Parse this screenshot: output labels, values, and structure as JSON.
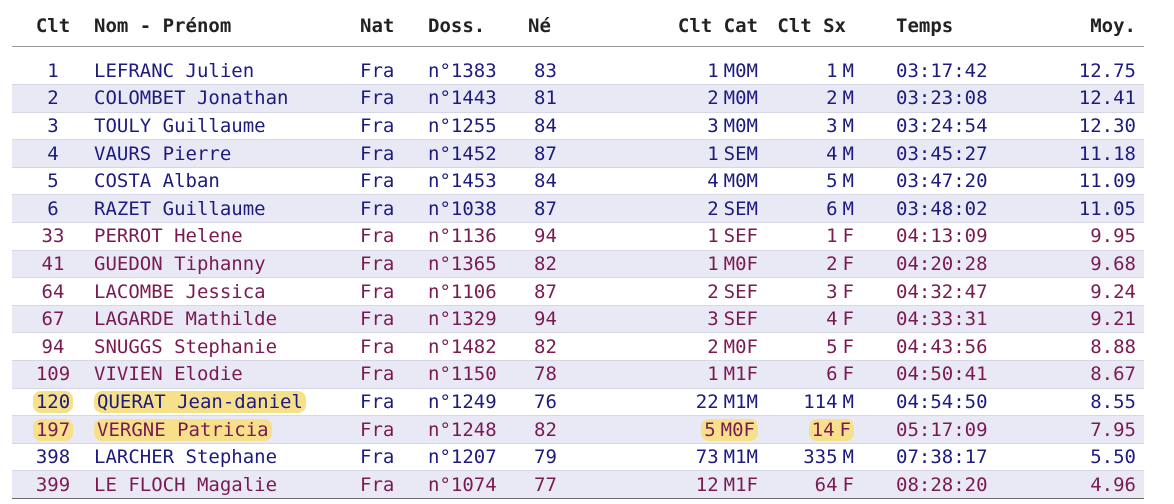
{
  "headers": {
    "clt": "Clt",
    "nom": "Nom - Prénom",
    "nat": "Nat",
    "doss": "Doss.",
    "ne": "Né",
    "clt_cat": "Clt Cat",
    "clt_sx": "Clt Sx",
    "temps": "Temps",
    "moy": "Moy."
  },
  "rows": [
    {
      "clt": "1",
      "name": "LEFRANC Julien",
      "nat": "Fra",
      "doss": "n°1383",
      "ne": "83",
      "clt_cat": "1",
      "cat": "M0M",
      "clt_sx": "1",
      "sx": "M",
      "temps": "03:17:42",
      "moy": "12.75",
      "gender": "male",
      "highlight": false
    },
    {
      "clt": "2",
      "name": "COLOMBET Jonathan",
      "nat": "Fra",
      "doss": "n°1443",
      "ne": "81",
      "clt_cat": "2",
      "cat": "M0M",
      "clt_sx": "2",
      "sx": "M",
      "temps": "03:23:08",
      "moy": "12.41",
      "gender": "male",
      "highlight": false
    },
    {
      "clt": "3",
      "name": "TOULY Guillaume",
      "nat": "Fra",
      "doss": "n°1255",
      "ne": "84",
      "clt_cat": "3",
      "cat": "M0M",
      "clt_sx": "3",
      "sx": "M",
      "temps": "03:24:54",
      "moy": "12.30",
      "gender": "male",
      "highlight": false
    },
    {
      "clt": "4",
      "name": "VAURS Pierre",
      "nat": "Fra",
      "doss": "n°1452",
      "ne": "87",
      "clt_cat": "1",
      "cat": "SEM",
      "clt_sx": "4",
      "sx": "M",
      "temps": "03:45:27",
      "moy": "11.18",
      "gender": "male",
      "highlight": false
    },
    {
      "clt": "5",
      "name": "COSTA Alban",
      "nat": "Fra",
      "doss": "n°1453",
      "ne": "84",
      "clt_cat": "4",
      "cat": "M0M",
      "clt_sx": "5",
      "sx": "M",
      "temps": "03:47:20",
      "moy": "11.09",
      "gender": "male",
      "highlight": false
    },
    {
      "clt": "6",
      "name": "RAZET Guillaume",
      "nat": "Fra",
      "doss": "n°1038",
      "ne": "87",
      "clt_cat": "2",
      "cat": "SEM",
      "clt_sx": "6",
      "sx": "M",
      "temps": "03:48:02",
      "moy": "11.05",
      "gender": "male",
      "highlight": false
    },
    {
      "clt": "33",
      "name": "PERROT Helene",
      "nat": "Fra",
      "doss": "n°1136",
      "ne": "94",
      "clt_cat": "1",
      "cat": "SEF",
      "clt_sx": "1",
      "sx": "F",
      "temps": "04:13:09",
      "moy": "9.95",
      "gender": "female",
      "highlight": false
    },
    {
      "clt": "41",
      "name": "GUEDON Tiphanny",
      "nat": "Fra",
      "doss": "n°1365",
      "ne": "82",
      "clt_cat": "1",
      "cat": "M0F",
      "clt_sx": "2",
      "sx": "F",
      "temps": "04:20:28",
      "moy": "9.68",
      "gender": "female",
      "highlight": false
    },
    {
      "clt": "64",
      "name": "LACOMBE Jessica",
      "nat": "Fra",
      "doss": "n°1106",
      "ne": "87",
      "clt_cat": "2",
      "cat": "SEF",
      "clt_sx": "3",
      "sx": "F",
      "temps": "04:32:47",
      "moy": "9.24",
      "gender": "female",
      "highlight": false
    },
    {
      "clt": "67",
      "name": "LAGARDE Mathilde",
      "nat": "Fra",
      "doss": "n°1329",
      "ne": "94",
      "clt_cat": "3",
      "cat": "SEF",
      "clt_sx": "4",
      "sx": "F",
      "temps": "04:33:31",
      "moy": "9.21",
      "gender": "female",
      "highlight": false
    },
    {
      "clt": "94",
      "name": "SNUGGS Stephanie",
      "nat": "Fra",
      "doss": "n°1482",
      "ne": "82",
      "clt_cat": "2",
      "cat": "M0F",
      "clt_sx": "5",
      "sx": "F",
      "temps": "04:43:56",
      "moy": "8.88",
      "gender": "female",
      "highlight": false
    },
    {
      "clt": "109",
      "name": "VIVIEN Elodie",
      "nat": "Fra",
      "doss": "n°1150",
      "ne": "78",
      "clt_cat": "1",
      "cat": "M1F",
      "clt_sx": "6",
      "sx": "F",
      "temps": "04:50:41",
      "moy": "8.67",
      "gender": "female",
      "highlight": false
    },
    {
      "clt": "120",
      "name": "QUERAT Jean-daniel",
      "nat": "Fra",
      "doss": "n°1249",
      "ne": "76",
      "clt_cat": "22",
      "cat": "M1M",
      "clt_sx": "114",
      "sx": "M",
      "temps": "04:54:50",
      "moy": "8.55",
      "gender": "male",
      "highlight": true
    },
    {
      "clt": "197",
      "name": "VERGNE Patricia",
      "nat": "Fra",
      "doss": "n°1248",
      "ne": "82",
      "clt_cat": "5",
      "cat": "M0F",
      "clt_sx": "14",
      "sx": "F",
      "temps": "05:17:09",
      "moy": "7.95",
      "gender": "female",
      "highlight": true
    },
    {
      "clt": "398",
      "name": "LARCHER Stephane",
      "nat": "Fra",
      "doss": "n°1207",
      "ne": "79",
      "clt_cat": "73",
      "cat": "M1M",
      "clt_sx": "335",
      "sx": "M",
      "temps": "07:38:17",
      "moy": "5.50",
      "gender": "male",
      "highlight": false
    },
    {
      "clt": "399",
      "name": "LE FLOCH Magalie",
      "nat": "Fra",
      "doss": "n°1074",
      "ne": "77",
      "clt_cat": "12",
      "cat": "M1F",
      "clt_sx": "64",
      "sx": "F",
      "temps": "08:28:20",
      "moy": "4.96",
      "gender": "female",
      "highlight": false
    }
  ]
}
